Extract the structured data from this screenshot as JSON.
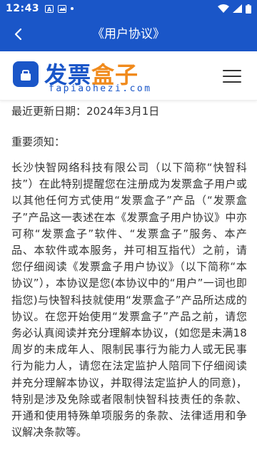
{
  "status": {
    "time": "12:43",
    "left_badges": [
      "A",
      "M"
    ]
  },
  "nav": {
    "title": "《用户协议》"
  },
  "logo": {
    "cn_main": "发票",
    "cn_accent": "盒子",
    "en": "fapiaohezi.com"
  },
  "colors": {
    "brand_blue": "#1a56c8",
    "accent_orange": "#f08a1c",
    "text": "#333333"
  },
  "icons": {
    "back": "chevron-left-icon",
    "menu": "hamburger-menu-icon",
    "wifi": "wifi-icon",
    "signal": "signal-icon",
    "battery": "battery-icon"
  },
  "agreement": {
    "updated": "最近更新日期：2024年3月1日",
    "notice_heading": "重要须知：",
    "paragraph": "长沙快智网络科技有限公司（以下简称“快智科技”）在此特别提醒您在注册成为发票盒子用户或以其他任何方式使用“发票盒子”产品（“发票盒子”产品这一表述在本《发票盒子用户协议》中亦可称“发票盒子”软件、“发票盒子”服务、本产品、本软件或本服务，并可相互指代）之前，请您仔细阅读《发票盒子用户协议》（以下简称“本协议”），本协议是您(本协议中的“用户”一词也即指您)与快智科技就使用“发票盒子”产品所达成的协议。在您开始使用“发票盒子”产品之前，请您务必认真阅读并充分理解本协议，(如您是未满18周岁的未成年人、限制民事行为能力人或无民事行为能力人，请您在法定监护人陪同下仔细阅读并充分理解本协议，并取得法定监护人的同意)，特别是涉及免除或者限制快智科技责任的条款、开通和使用特殊单项服务的条款、法律适用和争议解决条款等。"
  }
}
